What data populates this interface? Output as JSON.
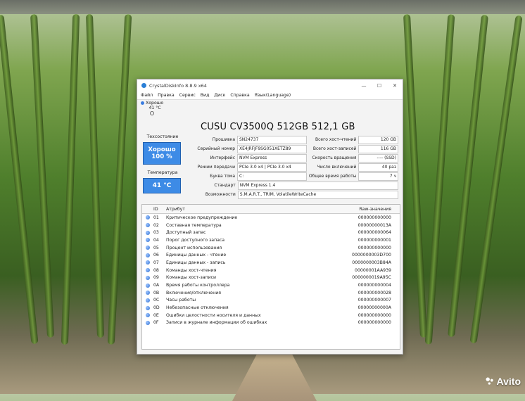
{
  "window": {
    "title": "CrystalDiskInfo 8.8.9 x64"
  },
  "menu": [
    "Файл",
    "Правка",
    "Сервис",
    "Вид",
    "Диск",
    "Справка",
    "Язык(Language)"
  ],
  "mini_status": {
    "health": "Хорошо",
    "temp": "41 °C"
  },
  "disk": {
    "title": "CUSU CV3500Q 512GB 512,1 GB"
  },
  "left_panel": {
    "health_label": "Техсостояние",
    "health_text": "Хорошо",
    "health_percent": "100 %",
    "temp_label": "Температура",
    "temp_value": "41 °C"
  },
  "info_left": [
    {
      "label": "Прошивка",
      "value": "SN24737"
    },
    {
      "label": "Серийный номер",
      "value": "XE4JRFJF9SG051XETZ89"
    },
    {
      "label": "Интерфейс",
      "value": "NVM Express"
    },
    {
      "label": "Режим передачи",
      "value": "PCIe 3.0 x4 | PCIe 3.0 x4"
    },
    {
      "label": "Буква тома",
      "value": "C:"
    }
  ],
  "info_right": [
    {
      "label": "Всего хост-чтений",
      "value": "120 GB"
    },
    {
      "label": "Всего хост-записей",
      "value": "116 GB"
    },
    {
      "label": "Скорость вращения",
      "value": "---- (SSD)"
    },
    {
      "label": "Число включений",
      "value": "40 раз"
    },
    {
      "label": "Общее время работы",
      "value": "7 ч"
    }
  ],
  "info_wide": [
    {
      "label": "Стандарт",
      "value": "NVM Express 1.4"
    },
    {
      "label": "Возможности",
      "value": "S.M.A.R.T., TRIM, VolatileWriteCache"
    }
  ],
  "smart": {
    "headers": {
      "id": "ID",
      "attr": "Атрибут",
      "raw": "Raw-значения"
    },
    "rows": [
      {
        "id": "01",
        "attr": "Критическое предупреждение",
        "raw": "000000000000"
      },
      {
        "id": "02",
        "attr": "Составная температура",
        "raw": "00000000013A"
      },
      {
        "id": "03",
        "attr": "Доступный запас",
        "raw": "000000000064"
      },
      {
        "id": "04",
        "attr": "Порог доступного запаса",
        "raw": "000000000001"
      },
      {
        "id": "05",
        "attr": "Процент использования",
        "raw": "000000000000"
      },
      {
        "id": "06",
        "attr": "Единицы данных - чтение",
        "raw": "0000000003D700"
      },
      {
        "id": "07",
        "attr": "Единицы данных - запись",
        "raw": "0000000003B84A"
      },
      {
        "id": "08",
        "attr": "Команды хост-чтения",
        "raw": "00000001AA939"
      },
      {
        "id": "09",
        "attr": "Команды хост-записи",
        "raw": "0000000019A95C"
      },
      {
        "id": "0A",
        "attr": "Время работы контроллера",
        "raw": "000000000004"
      },
      {
        "id": "0B",
        "attr": "Включения/отключения",
        "raw": "000000000028"
      },
      {
        "id": "0C",
        "attr": "Часы работы",
        "raw": "000000000007"
      },
      {
        "id": "0D",
        "attr": "Небезопасные отключения",
        "raw": "00000000000A"
      },
      {
        "id": "0E",
        "attr": "Ошибки целостности носителя и данных",
        "raw": "000000000000"
      },
      {
        "id": "0F",
        "attr": "Записи в журнале информации об ошибках",
        "raw": "000000000000"
      }
    ]
  },
  "watermark": {
    "text": "Avito"
  },
  "colors": {
    "health_blue": "#3d8be6",
    "status_dot": "#2f6fd1"
  }
}
